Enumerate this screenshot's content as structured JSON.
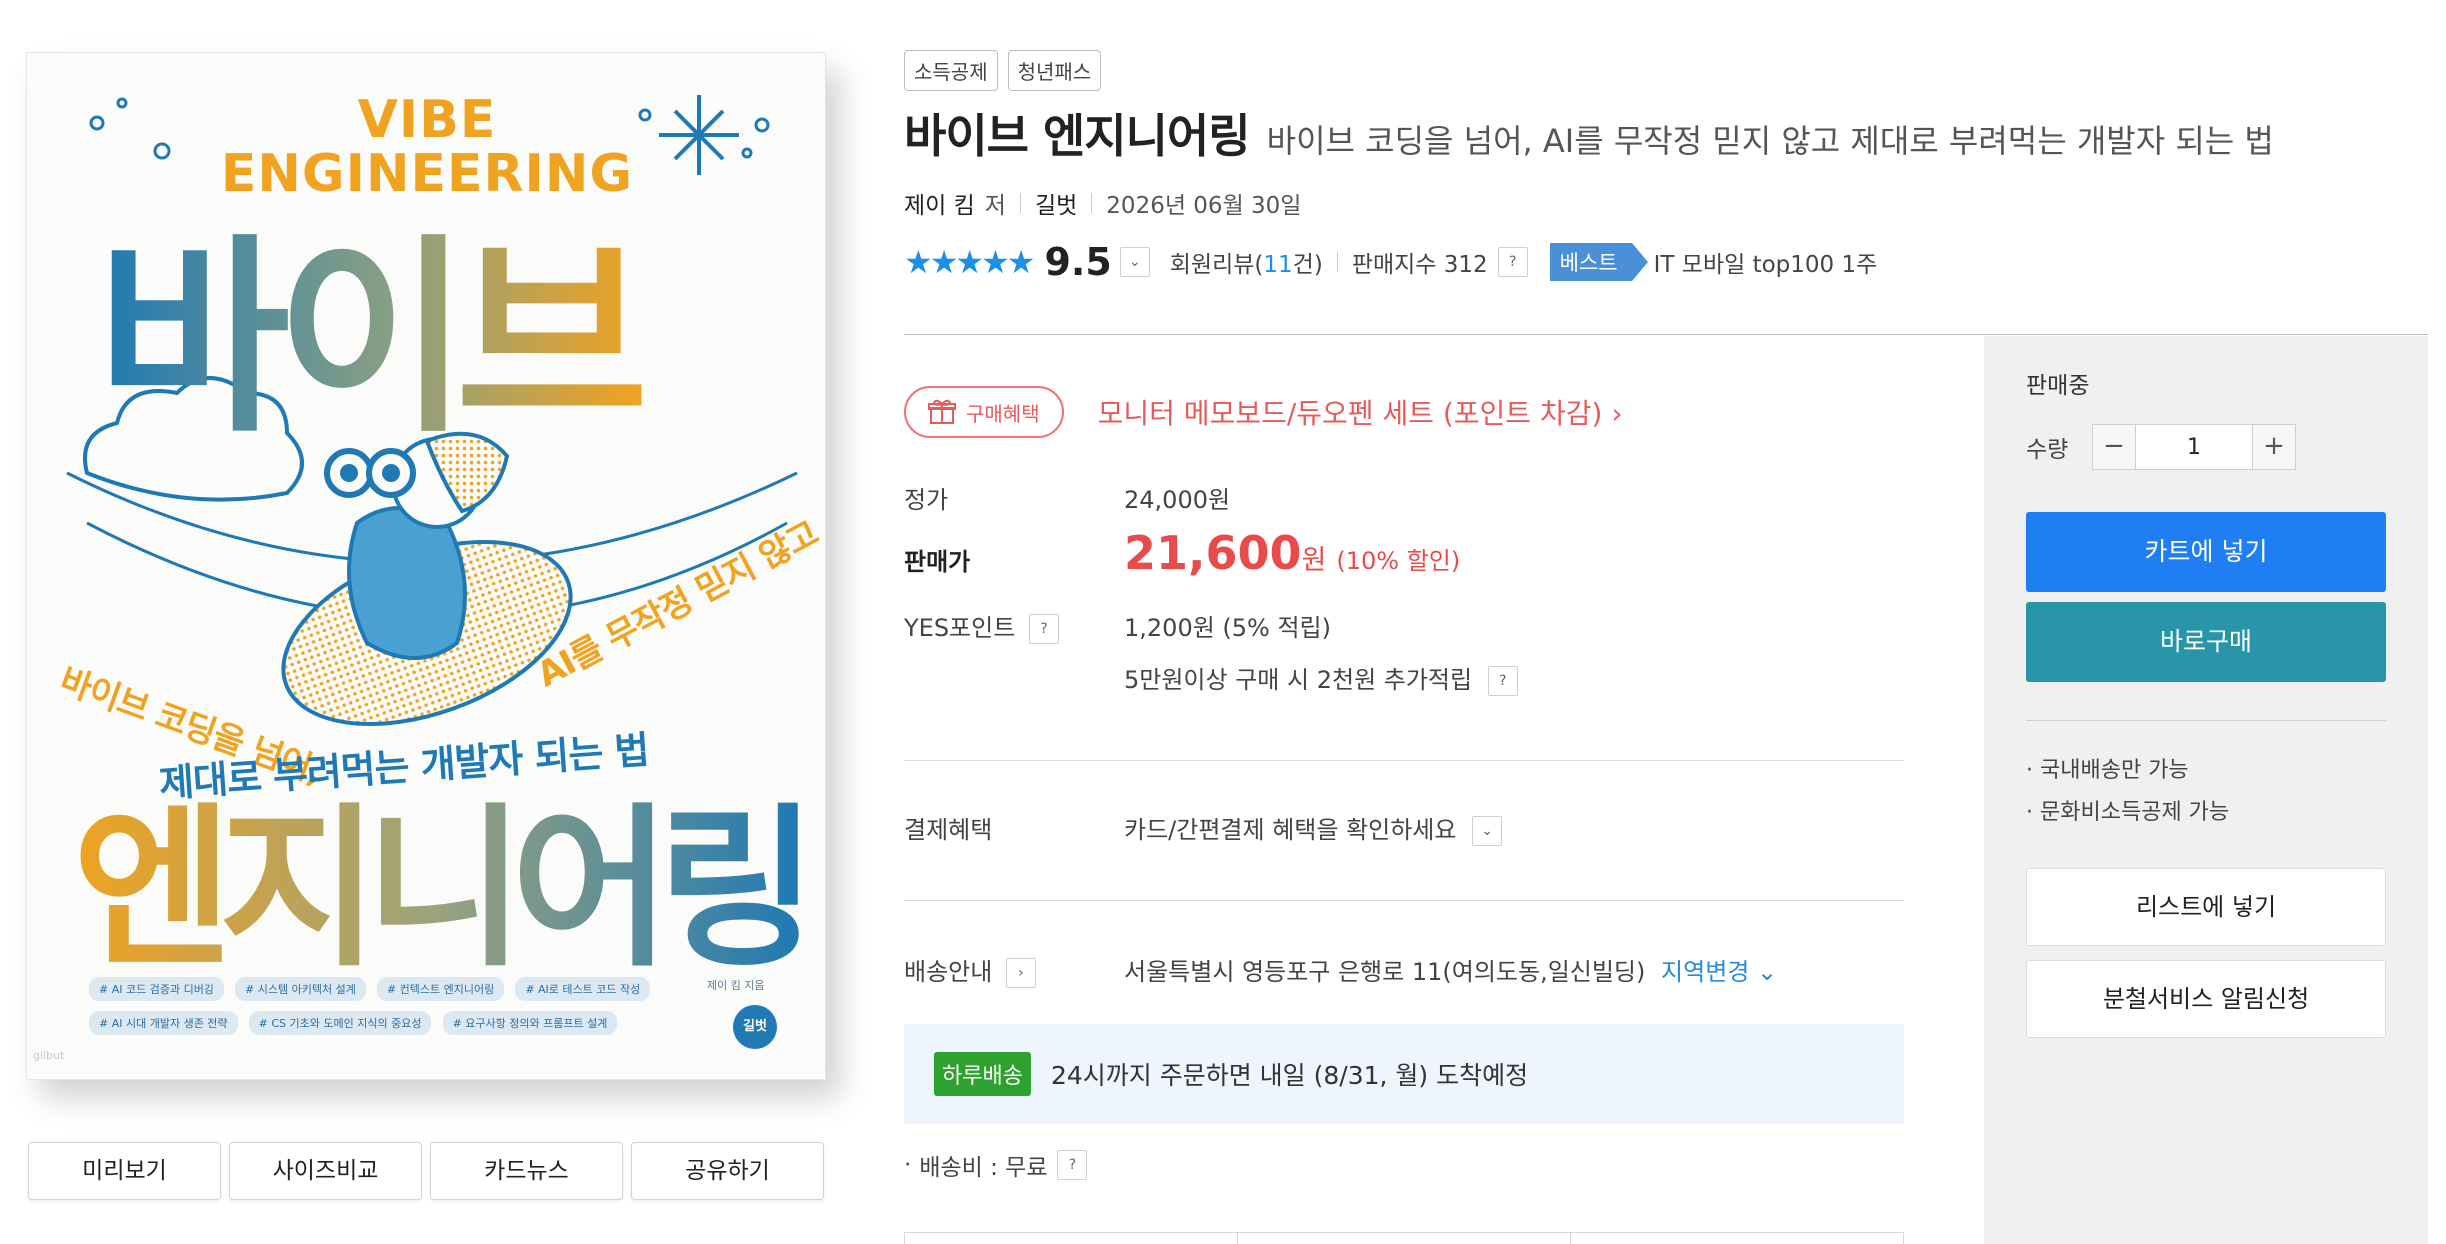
{
  "cover": {
    "vibe_line1": "VIBE",
    "vibe_line2": "ENGINEERING",
    "title_top": "바이브",
    "title_bottom": "엔지니어링",
    "subtitle_left": "바이브 코딩을 넘어,",
    "subtitle_right": "AI를 무작정 믿지 않고",
    "subtitle_bottom": "제대로 부려먹는 개발자 되는 법",
    "tags": [
      "# AI 코드 검증과 디버깅",
      "# 시스템 아키텍처 설계",
      "# 컨텍스트 엔지니어링",
      "# AI로 테스트 코드 작성",
      "# AI 시대 개발자 생존 전략",
      "# CS 기초와 도메인 지식의 중요성",
      "# 요구사항 정의와 프롬프트 설계"
    ],
    "author": "제이 킴 지음",
    "publisher_mark": "길벗",
    "publisher_small": "gilbut"
  },
  "thumb_buttons": [
    "미리보기",
    "사이즈비교",
    "카드뉴스",
    "공유하기"
  ],
  "badges": [
    "소득공제",
    "청년패스"
  ],
  "title": "바이브 엔지니어링",
  "subtitle": "바이브 코딩을 넘어, AI를 무작정 믿지 않고 제대로 부려먹는 개발자 되는 법",
  "meta": {
    "author": "제이 킴",
    "author_suffix": "저",
    "publisher": "길벗",
    "date": "2026년 06월 30일"
  },
  "rating": {
    "stars": "★★★★★",
    "score": "9.5",
    "review_label_pre": "회원리뷰(",
    "review_count": "11",
    "review_label_post": "건)",
    "sales_index": "판매지수 312",
    "best_label": "베스트",
    "rank_text": "IT 모바일 top100 1주"
  },
  "benefit": {
    "pill_label": "구매혜택",
    "text": "모니터 메모보드/듀오펜 세트 (포인트 차감)",
    "arrow": "›"
  },
  "price": {
    "list_label": "정가",
    "list_value": "24,000원",
    "sale_label": "판매가",
    "sale_value": "21,600",
    "sale_won": "원",
    "discount": "(10% 할인)",
    "points_label": "YES포인트",
    "points_value": "1,200원 (5% 적립)",
    "points_extra": "5만원이상 구매 시 2천원 추가적립"
  },
  "payment": {
    "label": "결제혜택",
    "value": "카드/간편결제 혜택을 확인하세요"
  },
  "shipping": {
    "label": "배송안내",
    "address": "서울특별시 영등포구 은행로 11(여의도동,일신빌딩)",
    "change_link": "지역변경",
    "badge": "하루배송",
    "eta": "24시까지 주문하면 내일 (8/31, 월) 도착예정",
    "fee": "배송비 : 무료"
  },
  "panel": {
    "status": "판매중",
    "qty_label": "수량",
    "qty_value": "1",
    "minus": "−",
    "plus": "+",
    "cart_button": "카트에 넣기",
    "buy_button": "바로구매",
    "notes": [
      "국내배송만 가능",
      "문화비소득공제 가능"
    ],
    "list_button": "리스트에 넣기",
    "alert_button": "분철서비스 알림신청"
  },
  "colors": {
    "accent_red": "#e84b4b",
    "cart_blue": "#1f7ff2",
    "buy_teal": "#2896a8",
    "cover_orange": "#f0a321",
    "cover_blue": "#1f79b4"
  }
}
